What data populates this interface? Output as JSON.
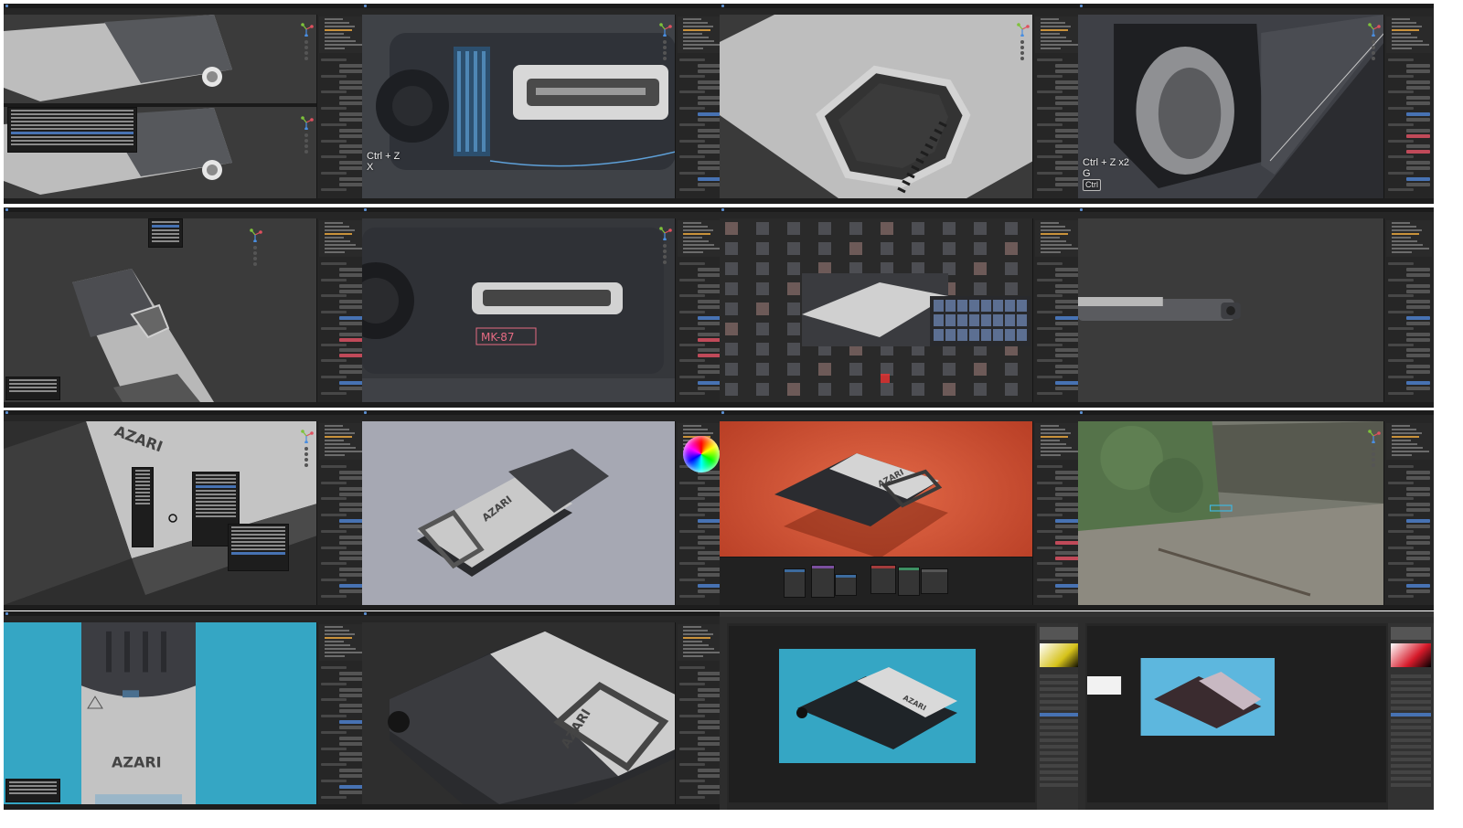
{
  "app": "Blender",
  "layout": {
    "columns": 4,
    "rows": 4
  },
  "colors": {
    "background": "#ffffff",
    "ui_dark": "#303030",
    "viewport": "#3b3b3b",
    "accent_blue": "#4772b3",
    "accent_orange": "#c9923b",
    "turntable_orange": "#d2583a",
    "studio_cyan": "#35a6c4",
    "label_pink": "#e56b83"
  },
  "tiles": [
    {
      "id": "t1",
      "kind": "viewport-split",
      "overlay": []
    },
    {
      "id": "t2",
      "kind": "viewport-closeup",
      "overlay": [
        "Ctrl + Z",
        "X"
      ]
    },
    {
      "id": "t3",
      "kind": "viewport-handle",
      "overlay": []
    },
    {
      "id": "t4",
      "kind": "viewport-interior",
      "overlay": [
        "Ctrl + Z x2",
        "G"
      ],
      "key_box": "Ctrl"
    },
    {
      "id": "t5",
      "kind": "viewport-topdown",
      "overlay": []
    },
    {
      "id": "t6",
      "kind": "viewport-decal",
      "overlay": [],
      "decal_text": "MK-87"
    },
    {
      "id": "t7",
      "kind": "asset-browser",
      "overlay": []
    },
    {
      "id": "t8",
      "kind": "viewport-side",
      "overlay": []
    },
    {
      "id": "t9",
      "kind": "viewport-menu",
      "overlay": [],
      "brand_text": "AZARI"
    },
    {
      "id": "t10",
      "kind": "viewport-color",
      "overlay": [],
      "brand_text": "AZARI"
    },
    {
      "id": "t11",
      "kind": "render-orange",
      "overlay": [],
      "brand_text": "AZARI"
    },
    {
      "id": "t12",
      "kind": "hdri-outdoor",
      "overlay": []
    },
    {
      "id": "t13",
      "kind": "ortho-top",
      "overlay": [],
      "brand_text": "AZARI"
    },
    {
      "id": "t14",
      "kind": "render-wide",
      "overlay": [],
      "brand_text": "AZARI"
    },
    {
      "id": "t15",
      "kind": "photoshop",
      "overlay": [],
      "brand_text": "AZARI"
    },
    {
      "id": "t16",
      "kind": "photoshop-2",
      "overlay": []
    }
  ]
}
